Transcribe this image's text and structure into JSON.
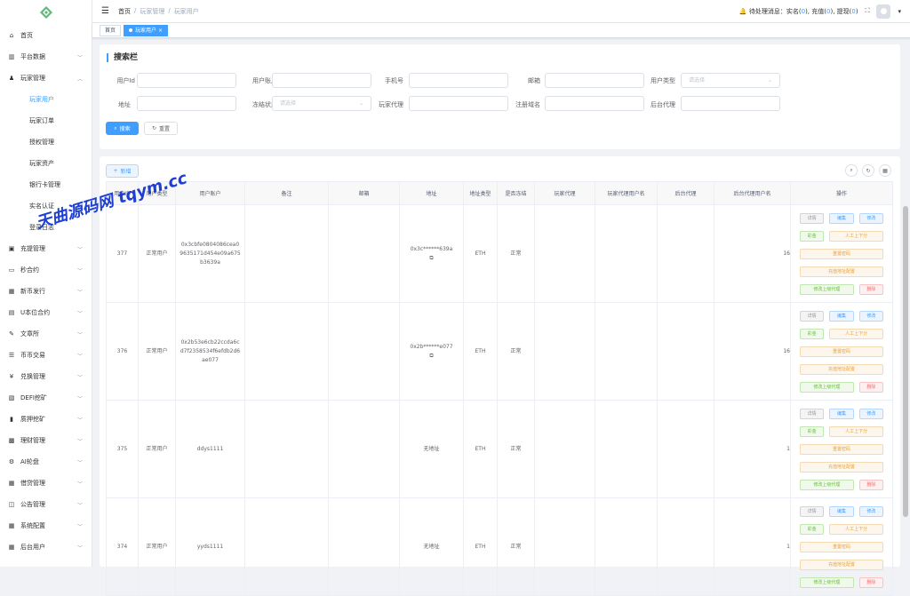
{
  "sidebar": {
    "items": [
      {
        "label": "首页",
        "icon": "home-icon",
        "glyph": "⌂",
        "arrow": false
      },
      {
        "label": "平台数据",
        "icon": "chart-icon",
        "glyph": "▥",
        "arrow": true
      },
      {
        "label": "玩家管理",
        "icon": "user-icon",
        "glyph": "♟",
        "arrow": true,
        "open": true,
        "children": [
          "玩家用户",
          "玩家订单",
          "授权管理",
          "玩家资产",
          "银行卡管理",
          "实名认证",
          "登录日志"
        ]
      },
      {
        "label": "充提管理",
        "icon": "wallet-icon",
        "glyph": "▣",
        "arrow": true
      },
      {
        "label": "秒合约",
        "icon": "monitor-icon",
        "glyph": "▭",
        "arrow": true
      },
      {
        "label": "新币发行",
        "icon": "coin-icon",
        "glyph": "▦",
        "arrow": true
      },
      {
        "label": "U本位合约",
        "icon": "contract-icon",
        "glyph": "▤",
        "arrow": true
      },
      {
        "label": "文章所",
        "icon": "doc-icon",
        "glyph": "✎",
        "arrow": true
      },
      {
        "label": "币币交易",
        "icon": "exchange-icon",
        "glyph": "☰",
        "arrow": true
      },
      {
        "label": "兑换管理",
        "icon": "yen-icon",
        "glyph": "¥",
        "arrow": true
      },
      {
        "label": "DEFI挖矿",
        "icon": "mining-icon",
        "glyph": "▧",
        "arrow": true
      },
      {
        "label": "质押挖矿",
        "icon": "bars-icon",
        "glyph": "▮",
        "arrow": true
      },
      {
        "label": "理财管理",
        "icon": "finance-icon",
        "glyph": "▩",
        "arrow": true
      },
      {
        "label": "AI轮盘",
        "icon": "ai-icon",
        "glyph": "⚙",
        "arrow": true
      },
      {
        "label": "借贷管理",
        "icon": "loan-icon",
        "glyph": "▦",
        "arrow": true
      },
      {
        "label": "公告管理",
        "icon": "notice-icon",
        "glyph": "◫",
        "arrow": true
      },
      {
        "label": "系统配置",
        "icon": "settings-icon",
        "glyph": "▦",
        "arrow": true
      },
      {
        "label": "后台用户",
        "icon": "admin-icon",
        "glyph": "▦",
        "arrow": true
      }
    ]
  },
  "navbar": {
    "breadcrumb": [
      "首页",
      "玩家管理",
      "玩家用户"
    ],
    "pending_label": "待处理消息：",
    "pending_items": [
      {
        "label": "实名",
        "count": "0"
      },
      {
        "label": "充值",
        "count": "0"
      },
      {
        "label": "提现",
        "count": "0"
      }
    ]
  },
  "tags": [
    {
      "label": "首页",
      "active": false
    },
    {
      "label": "玩家用户",
      "active": true
    }
  ],
  "search": {
    "title": "搜索栏",
    "fields": {
      "user_id": {
        "label": "用户Id",
        "value": ""
      },
      "user_account": {
        "label": "用户账户",
        "value": ""
      },
      "phone": {
        "label": "手机号",
        "value": ""
      },
      "email": {
        "label": "邮箱",
        "value": ""
      },
      "user_type": {
        "label": "用户类型",
        "placeholder": "请选择"
      },
      "address": {
        "label": "地址",
        "value": ""
      },
      "freeze_status": {
        "label": "冻结状态",
        "placeholder": "请选择"
      },
      "player_agent": {
        "label": "玩家代理",
        "value": ""
      },
      "register_domain": {
        "label": "注册域名",
        "value": ""
      },
      "admin_agent": {
        "label": "后台代理",
        "value": ""
      }
    },
    "search_button": "搜索",
    "reset_button": "重置"
  },
  "table": {
    "add_button": "新增",
    "columns": [
      "用户ID",
      "用户类型",
      "用户账户",
      "备注",
      "邮箱",
      "地址",
      "地址类型",
      "是否冻结",
      "玩家代理",
      "玩家代理用户名",
      "后台代理",
      "后台代理用户名",
      "操作"
    ],
    "rows": [
      {
        "id": "377",
        "type": "正常用户",
        "account": "0x3cbfe0804086cea09635171d454e09a675b3639a",
        "address": "0x3c******639a",
        "copy": true,
        "addr_type": "ETH",
        "frozen": "正常",
        "agent_clip": "16"
      },
      {
        "id": "376",
        "type": "正常用户",
        "account": "0x2b53e6cb22ccda6cd7f2358534f6efdb2d6ae077",
        "address": "0x2b******e077",
        "copy": true,
        "addr_type": "ETH",
        "frozen": "正常",
        "agent_clip": "16"
      },
      {
        "id": "375",
        "type": "正常用户",
        "account": "ddys1111",
        "address": "无地址",
        "copy": false,
        "addr_type": "ETH",
        "frozen": "正常",
        "agent_clip": "1"
      },
      {
        "id": "374",
        "type": "正常用户",
        "account": "yyds1111",
        "address": "无地址",
        "copy": false,
        "addr_type": "ETH",
        "frozen": "正常",
        "agent_clip": "1"
      }
    ],
    "ops": {
      "detail": "详情",
      "group": "编集",
      "edit": "修改",
      "color": "彩金",
      "manual_score": "人工上下分",
      "reset_password": "重置密码",
      "address_config": "充值地址配置",
      "change_agent": "修改上级代理",
      "delete": "删除"
    }
  },
  "watermark": "天曲源码网 tqym.cc",
  "colors": {
    "primary": "#409eff",
    "watermark": "#1e3fd1"
  }
}
